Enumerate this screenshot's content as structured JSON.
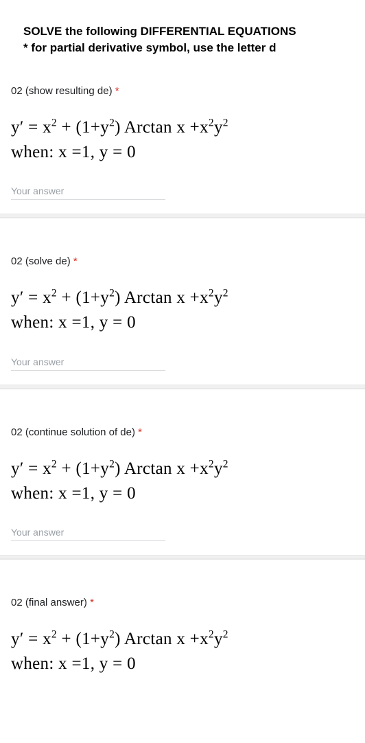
{
  "header": {
    "title": "SOLVE the following DIFFERENTIAL EQUATIONS",
    "subtitle": "* for partial derivative symbol, use the letter d"
  },
  "equation": {
    "line1_html": "y<span class='prime'>′</span> = x<sup>2</sup> + (1+y<sup>2</sup>) Arctan x +x<sup>2</sup>y<sup>2</sup>",
    "line2_html": "when: x =1, y = 0"
  },
  "questions": [
    {
      "label": "02 (show resulting de)",
      "required": true,
      "placeholder": "Your answer"
    },
    {
      "label": "02 (solve de)",
      "required": true,
      "placeholder": "Your answer"
    },
    {
      "label": "02 (continue solution of de)",
      "required": true,
      "placeholder": "Your answer"
    },
    {
      "label": "02 (final answer)",
      "required": true,
      "placeholder": ""
    }
  ]
}
